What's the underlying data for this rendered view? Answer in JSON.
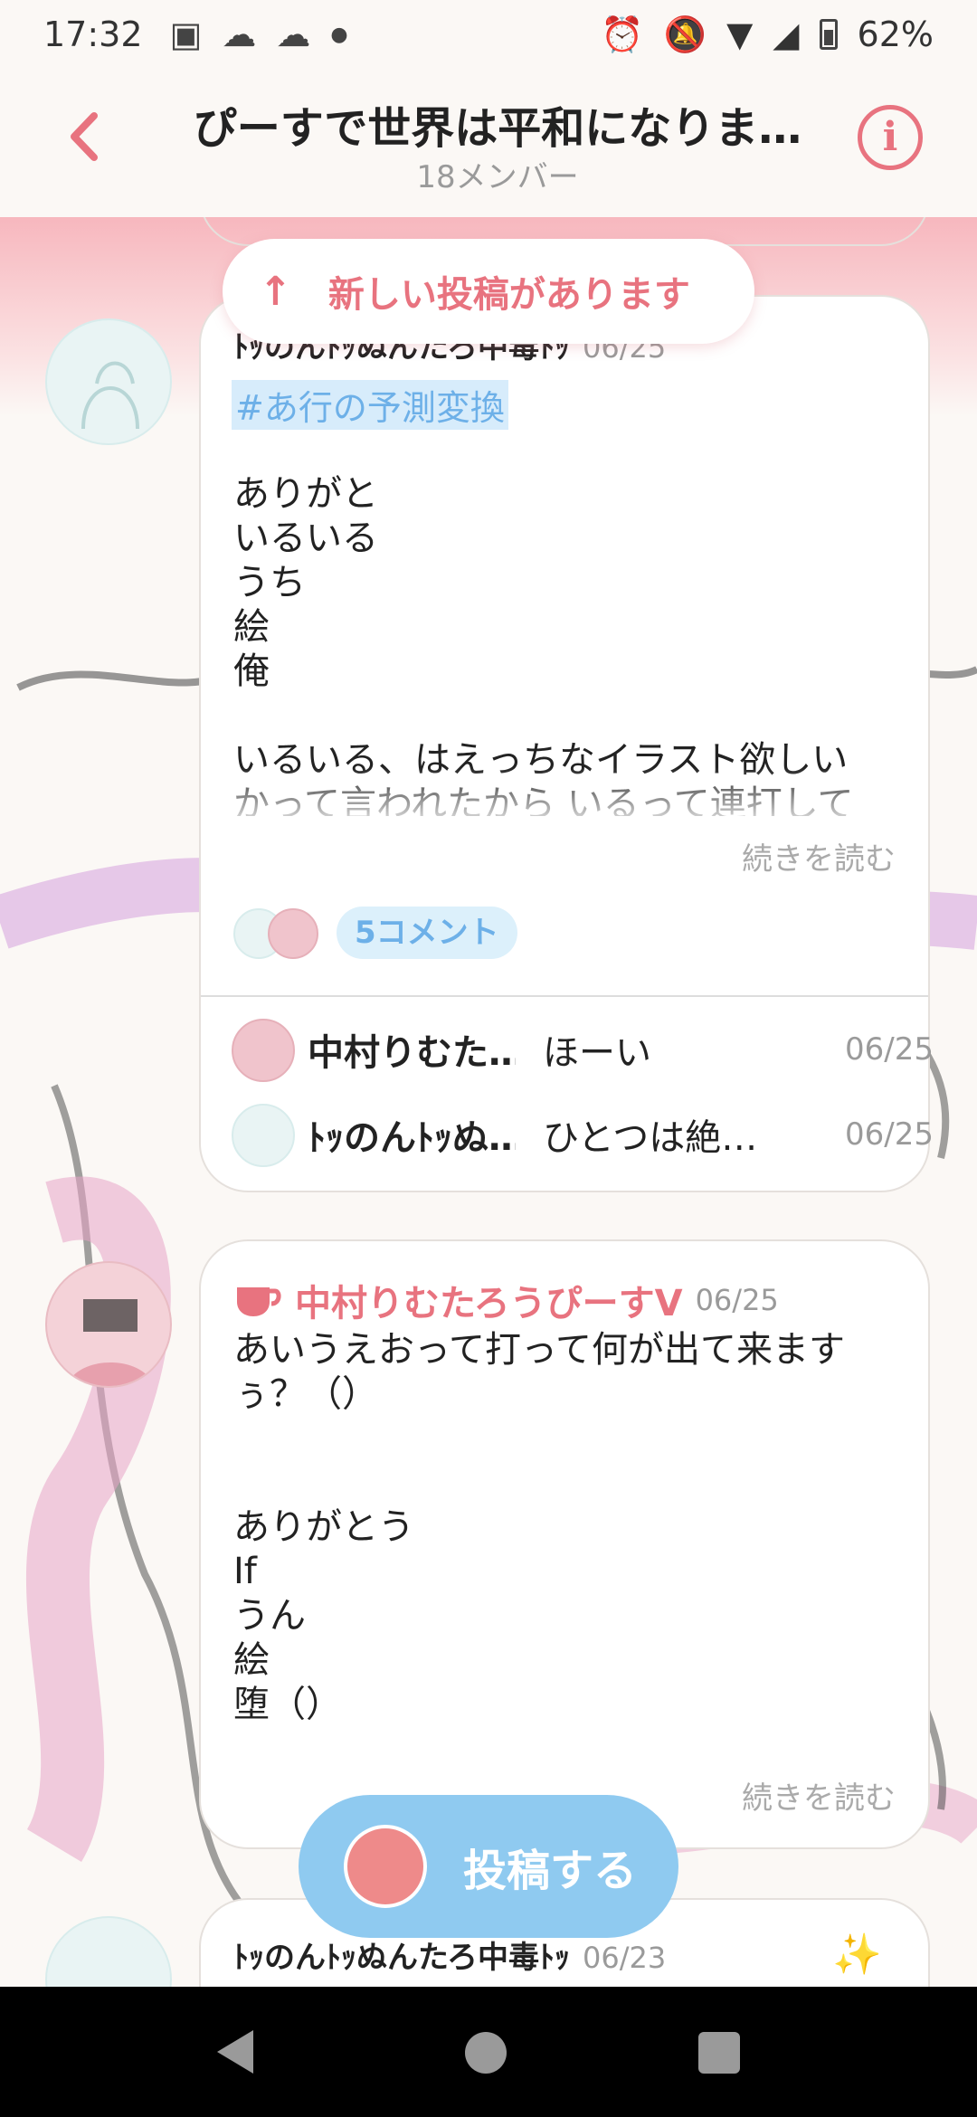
{
  "status": {
    "time": "17:32",
    "battery": "62%"
  },
  "header": {
    "title": "ぴーすで世界は平和になりま…",
    "members": "18メンバー"
  },
  "banner": {
    "new_posts": "新しい投稿があります"
  },
  "post1": {
    "author": "ﾄｯのんﾄｯぬんたろ中毒ﾄｯ",
    "date": "06/25",
    "hashtag": "#あ行の予測変換",
    "body": "ありがと\nいるいる\nうち\n絵\n俺\n\nいるいる、はえっちなイラスト欲しい\nかって言われたから いるって連打して",
    "read_more": "続きを読む",
    "comment_count": "5コメント",
    "comments": [
      {
        "name": "中村りむた…",
        "text": "ほーい",
        "date": "06/25"
      },
      {
        "name": "ﾄｯのんﾄｯぬ…",
        "text": "ひとつは絶…",
        "date": "06/25"
      }
    ]
  },
  "post2": {
    "author": "中村りむたろうぴーすV",
    "date": "06/25",
    "body": "あいうえおって打って何が出て来ます\nぅ？（）\n\n\nありがとう\nIf\nうん\n絵\n堕（）",
    "read_more": "続きを読む"
  },
  "post3": {
    "author": "ﾄｯのんﾄｯぬんたろ中毒ﾄｯ",
    "date": "06/23",
    "sparkle": "✨"
  },
  "fab": {
    "label": "投稿する"
  },
  "icons": {
    "back": "chevron-left-icon",
    "info": "info-icon",
    "cup": "cup-icon"
  },
  "colors": {
    "accent": "#e8737f",
    "blue": "#8fcaf0",
    "band": "#f7b7be"
  }
}
